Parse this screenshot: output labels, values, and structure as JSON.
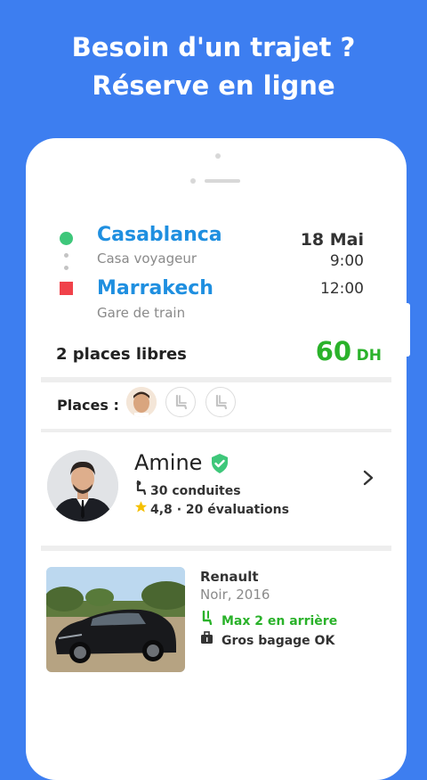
{
  "headline": {
    "line1": "Besoin d'un trajet ?",
    "line2": "Réserve en ligne"
  },
  "trip": {
    "departure_city": "Casablanca",
    "departure_station": "Casa voyageur",
    "arrival_city": "Marrakech",
    "arrival_station": "Gare de train",
    "date": "18 Mai",
    "departure_time": "9:00",
    "arrival_time": "12:00"
  },
  "availability": {
    "places_free": "2 places libres",
    "price_value": "60",
    "price_currency": "DH"
  },
  "places": {
    "label": "Places :"
  },
  "driver": {
    "name": "Amine",
    "rides": "30 conduites",
    "rating": "4,8",
    "separator": "·",
    "reviews": "20 évaluations"
  },
  "car": {
    "brand": "Renault",
    "color_year": "Noir, 2016",
    "rear_limit": "Max 2 en arrière",
    "luggage": "Gros bagage OK"
  },
  "colors": {
    "background": "#3d7ef0",
    "city": "#1f8fe0",
    "price": "#2ab22a",
    "start_dot": "#3ec77a",
    "end_square": "#f0424a",
    "verified": "#3ec77a"
  }
}
